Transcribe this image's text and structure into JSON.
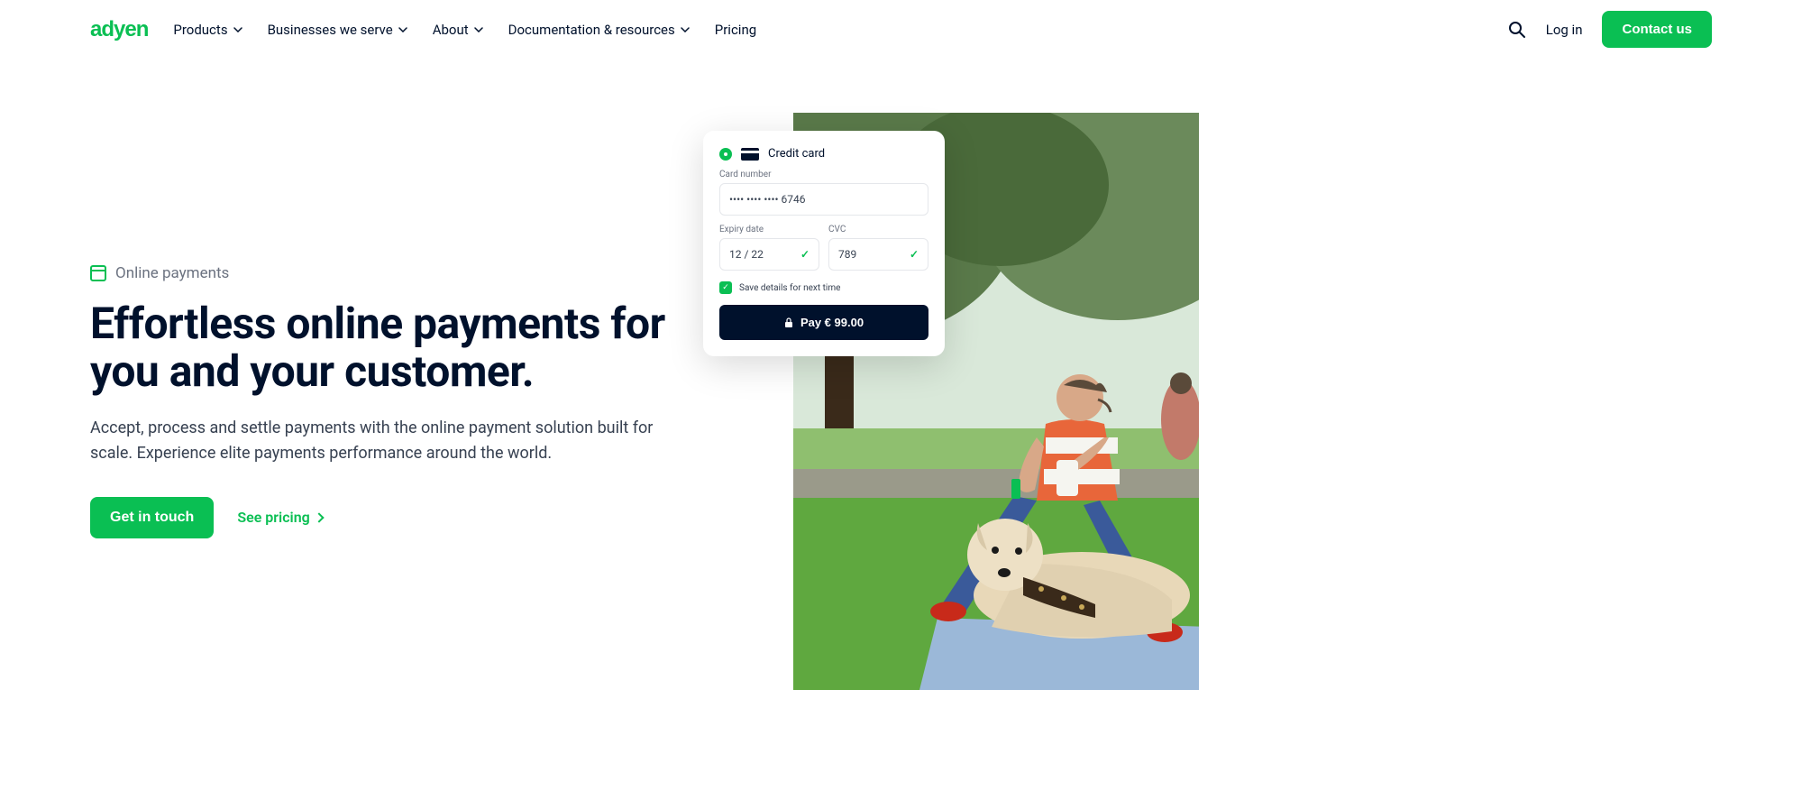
{
  "header": {
    "logo": "adyen",
    "nav": {
      "products": "Products",
      "businesses": "Businesses we serve",
      "about": "About",
      "docs": "Documentation & resources",
      "pricing": "Pricing"
    },
    "login": "Log in",
    "contact": "Contact us"
  },
  "hero": {
    "eyebrow": "Online payments",
    "title": "Effortless online payments for you and your customer.",
    "description": "Accept, process and settle payments with the online payment solution built for scale. Experience elite payments performance around the world.",
    "cta_primary": "Get in touch",
    "cta_secondary": "See pricing"
  },
  "checkout": {
    "method_label": "Credit card",
    "card_number_label": "Card number",
    "card_number_value": "•••• •••• •••• 6746",
    "expiry_label": "Expiry date",
    "expiry_value": "12 / 22",
    "cvc_label": "CVC",
    "cvc_value": "789",
    "save_label": "Save details for next time",
    "pay_label": "Pay € 99.00"
  }
}
